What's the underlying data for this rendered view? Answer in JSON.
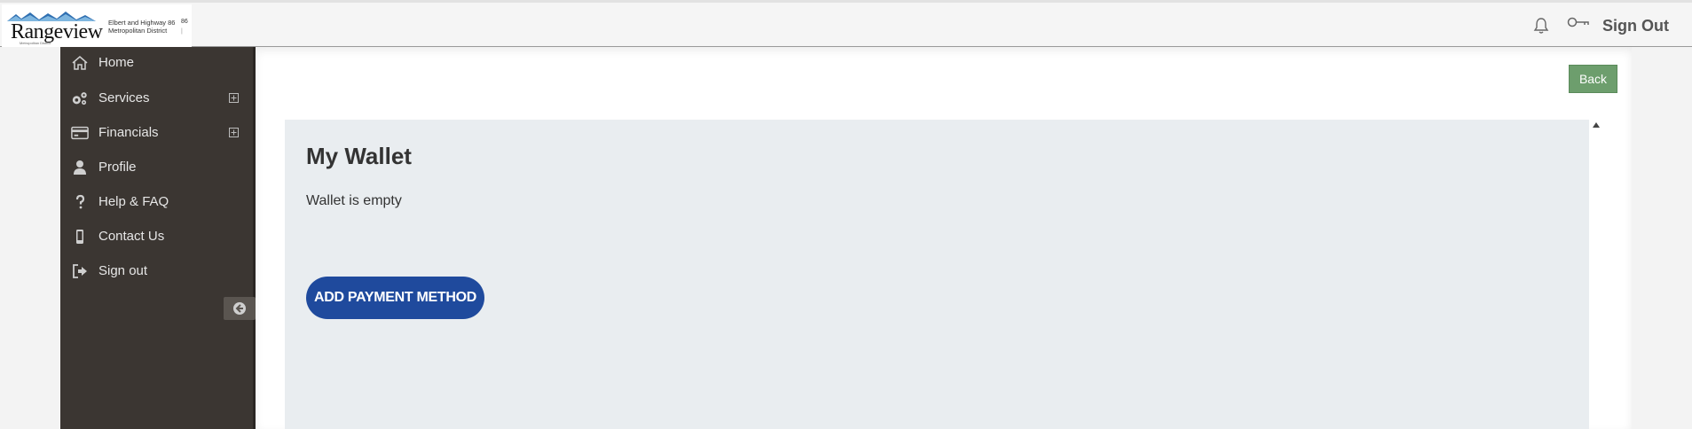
{
  "header": {
    "logo": {
      "word": "Rangeview",
      "sub": "Metropolitan District",
      "side_line1": "Elbert and Highway 86",
      "side_line2": "Metropolitan District",
      "num": "86",
      "pipe": "|"
    },
    "signout_label": "Sign Out",
    "icons": [
      "bell-icon",
      "key-icon"
    ]
  },
  "sidebar": {
    "items": [
      {
        "label": "Home",
        "icon": "home-icon"
      },
      {
        "label": "Services",
        "icon": "gears-icon",
        "expandable": true
      },
      {
        "label": "Financials",
        "icon": "credit-card-icon",
        "expandable": true
      },
      {
        "label": "Profile",
        "icon": "user-icon"
      },
      {
        "label": "Help & FAQ",
        "icon": "question-icon"
      },
      {
        "label": "Contact Us",
        "icon": "mobile-icon"
      },
      {
        "label": "Sign out",
        "icon": "sign-out-icon"
      }
    ]
  },
  "main": {
    "back_label": "Back",
    "wallet": {
      "title": "My Wallet",
      "message": "Wallet is empty",
      "add_label": "ADD PAYMENT METHOD"
    }
  },
  "colors": {
    "sidebar_bg": "#3b3632",
    "card_bg": "#e9edf0",
    "primary": "#1f4a9d",
    "back_button": "#6d9e6d"
  }
}
